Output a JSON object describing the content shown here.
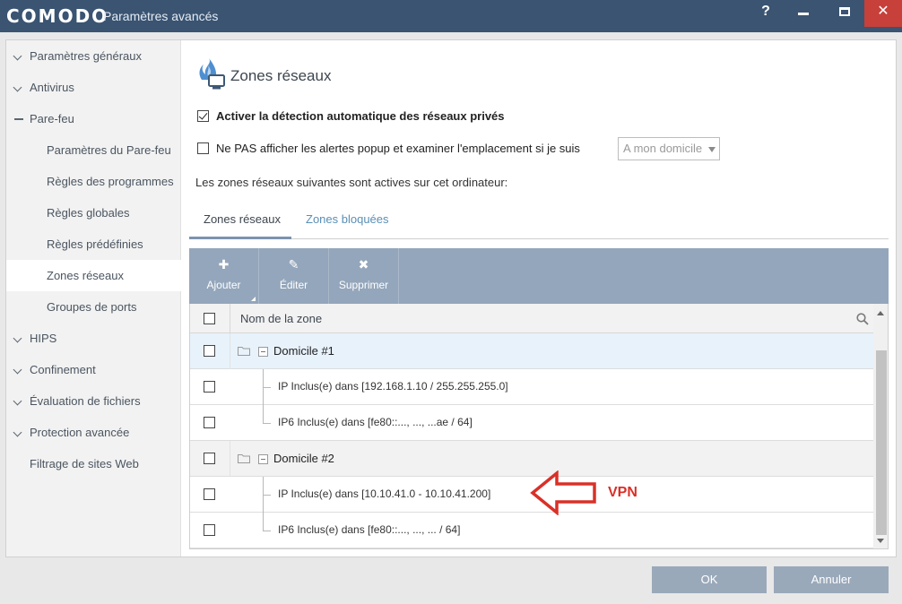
{
  "window": {
    "brand": "COMODO",
    "title": "Paramètres avancés",
    "help": "?"
  },
  "sidebar": {
    "items": [
      {
        "label": "Paramètres généraux",
        "level": 0,
        "toggle": "expand"
      },
      {
        "label": "Antivirus",
        "level": 0,
        "toggle": "expand"
      },
      {
        "label": "Pare-feu",
        "level": 0,
        "toggle": "collapse"
      },
      {
        "label": "Paramètres du Pare-feu",
        "level": 1
      },
      {
        "label": "Règles des programmes",
        "level": 1
      },
      {
        "label": "Règles globales",
        "level": 1
      },
      {
        "label": "Règles prédéfinies",
        "level": 1
      },
      {
        "label": "Zones réseaux",
        "level": 1,
        "selected": true
      },
      {
        "label": "Groupes de ports",
        "level": 1
      },
      {
        "label": "HIPS",
        "level": 0,
        "toggle": "expand"
      },
      {
        "label": "Confinement",
        "level": 0,
        "toggle": "expand"
      },
      {
        "label": "Évaluation de fichiers",
        "level": 0,
        "toggle": "expand"
      },
      {
        "label": "Protection avancée",
        "level": 0,
        "toggle": "expand"
      },
      {
        "label": "Filtrage de sites Web",
        "level": 0
      }
    ]
  },
  "page": {
    "title": "Zones réseaux",
    "icon": "firewall-network-icon",
    "option1": {
      "label": "Activer la détection automatique des réseaux privés",
      "checked": true
    },
    "option2": {
      "label": "Ne PAS afficher les alertes popup et examiner l'emplacement si je suis",
      "checked": false
    },
    "location_select": {
      "value": "A mon domicile"
    },
    "info": "Les zones réseaux suivantes sont actives sur cet ordinateur:"
  },
  "tabs": [
    {
      "label": "Zones réseaux",
      "active": true
    },
    {
      "label": "Zones bloquées",
      "active": false
    }
  ],
  "toolbar": {
    "add": {
      "label": "Ajouter",
      "icon": "plus-icon"
    },
    "edit": {
      "label": "Éditer",
      "icon": "pencil-icon"
    },
    "delete": {
      "label": "Supprimer",
      "icon": "x-icon"
    }
  },
  "grid": {
    "column": "Nom de la zone",
    "rows": [
      {
        "type": "group",
        "text": "Domicile #1",
        "selected": true
      },
      {
        "type": "child",
        "text": "IP Inclus(e) dans [192.168.1.10 / 255.255.255.0]"
      },
      {
        "type": "child",
        "text": "IP6 Inclus(e) dans [fe80::..., ..., ...ae / 64]"
      },
      {
        "type": "group",
        "text": "Domicile #2"
      },
      {
        "type": "child",
        "text": "IP Inclus(e) dans [10.10.41.0 - 10.10.41.200]"
      },
      {
        "type": "child",
        "text": "IP6 Inclus(e) dans [fe80::..., ..., ... / 64]"
      }
    ]
  },
  "annotation": {
    "label": "VPN",
    "color": "#d93028"
  },
  "footer": {
    "ok": "OK",
    "cancel": "Annuler"
  }
}
